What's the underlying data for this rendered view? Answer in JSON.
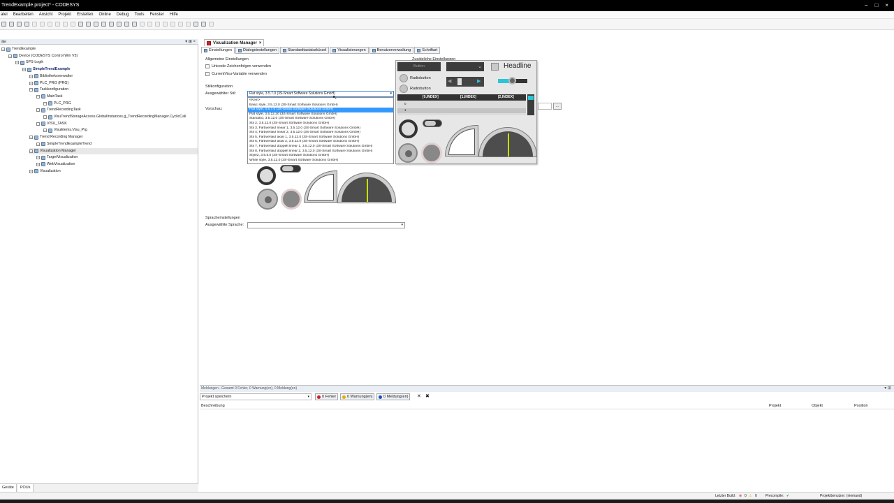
{
  "window": {
    "title": "TrendExample.project* - CODESYS",
    "controls": [
      "–",
      "□",
      "×"
    ]
  },
  "menu": [
    "atei",
    "Bearbeiten",
    "Ansicht",
    "Projekt",
    "Erstellen",
    "Online",
    "Debug",
    "Tools",
    "Fenster",
    "Hilfe"
  ],
  "left_panel": {
    "title": "äte",
    "tree": [
      {
        "label": "TrendExample",
        "indent": 0
      },
      {
        "label": "Device (CODESYS Control Win V3)",
        "indent": 1
      },
      {
        "label": "SPS-Logik",
        "indent": 2
      },
      {
        "label": "SimpleTrendExample",
        "indent": 3,
        "bold": true
      },
      {
        "label": "Bibliotheksverwalter",
        "indent": 4
      },
      {
        "label": "PLC_PRG (PRG)",
        "indent": 4
      },
      {
        "label": "Taskkonfiguration",
        "indent": 4
      },
      {
        "label": "MainTask",
        "indent": 5
      },
      {
        "label": "PLC_PRG",
        "indent": 6
      },
      {
        "label": "TrendRecordingTask",
        "indent": 5
      },
      {
        "label": "VisuTrendStorageAccess.GlobalInstances.g_TrendRecordingManager.CyclicCall",
        "indent": 6
      },
      {
        "label": "VISU_TASK",
        "indent": 5
      },
      {
        "label": "VisuElems.Visu_Prg",
        "indent": 6
      },
      {
        "label": "Trend Recording Manager",
        "indent": 4
      },
      {
        "label": "SimpleTrendExampleTrend",
        "indent": 5
      },
      {
        "label": "Visualization Manager",
        "indent": 4,
        "selected": true
      },
      {
        "label": "TargetVisualization",
        "indent": 5
      },
      {
        "label": "WebVisualization",
        "indent": 5
      },
      {
        "label": "Visualization",
        "indent": 4
      }
    ],
    "bottom_tabs": [
      "Geräte",
      "POUs"
    ]
  },
  "editor": {
    "doc_tab": "Visualization Manager",
    "tabs": [
      "Einstellungen",
      "Dialogeinstellungen",
      "Standardtastaturkürzel",
      "Visualisierungen",
      "Benutzerverwaltung",
      "Schriftart"
    ],
    "general_settings": {
      "title": "Allgemeine Einstellungen",
      "unicode": "Unicode-Zeichenfolgen verwenden",
      "currentvisu": "CurrentVisu-Variable verwenden"
    },
    "additional_settings": "Zusätzliche Einstellungen",
    "style": {
      "section": "Stilkonfiguration",
      "label": "Ausgewählter Stil:",
      "selected": "Flat style, 3.5.7.0 (3S-Smart Software Solutions GmbH)",
      "preview_label": "Vorschau:",
      "options": [
        "<Kein>",
        "Basic style, 3.5.12.0 (3S-Smart Software Solutions GmbH)",
        "Flat style, 3.5.7.0 (3S-Smart Software Solutions GmbH)",
        "Flat style, 3.5.12.20 (3S-Smart Software Solutions GmbH)",
        "Standard, 3.5.12.0 (3S-Smart Software Solutions GmbH)",
        "Stil 2, 3.5.12.0 (3S-Smart Software Solutions GmbH)",
        "Stil 3, Farbverlauf linear 1, 3.5.12.0 (3S-Smart Software Solutions GmbH)",
        "Stil 4, Farbverlauf linear 2, 3.5.12.0 (3S-Smart Software Solutions GmbH)",
        "Stil 5, Farbverlauf axial 1, 3.5.12.0 (3S-Smart Software Solutions GmbH)",
        "Stil 6, Farbverlauf axial 2, 3.5.12.0 (3S-Smart Software Solutions GmbH)",
        "Stil 7, Farbverlauf doppelt linear 1, 3.5.12.0 (3S-Smart Software Solutions GmbH)",
        "Stil 8, Farbverlauf doppelt linear 2, 3.5.12.0 (3S-Smart Software Solutions GmbH)",
        "Style2, 3.5.5.0 (3S-Smart Software Solutions GmbH)",
        "White style, 3.5.12.0 (3S-Smart Software Solutions GmbH)"
      ],
      "highlighted_index": 2,
      "browse": "..."
    },
    "language": {
      "section": "Spracheinstellungen",
      "label": "Ausgewählte Sprache:",
      "value": ""
    },
    "preview_popup": {
      "button": "Button",
      "headline": "Headline",
      "radio1": "Radiobutton",
      "radio2": "Radiobutton",
      "table_headers": [
        "[0,INDEX]",
        "[1,INDEX]",
        "[2,INDEX]"
      ],
      "row_labels": [
        "0",
        "1"
      ]
    }
  },
  "messages": {
    "header": "Meldungen - Gesamt 0 Fehler, 0 Warnung(en), 0 Meldung(en)",
    "filter": "Projekt speichern",
    "errors": "0 Fehler",
    "warnings": "0 Warnung(en)",
    "infos": "0 Meldung(en)",
    "columns": [
      "Beschreibung",
      "Projekt",
      "Objekt",
      "Position"
    ]
  },
  "status": {
    "last_build": "Letzter Build:",
    "errors": "0",
    "warnings": "0",
    "precompile": "Precompile:",
    "user": "Projektbenutzer: (niemand)"
  },
  "colors": {
    "accent": "#3399ff",
    "gauge_needle": "#c8e000",
    "toggle_on": "#2ec4d8",
    "error": "#d02020",
    "warning": "#e0b000",
    "info": "#2050c0"
  }
}
